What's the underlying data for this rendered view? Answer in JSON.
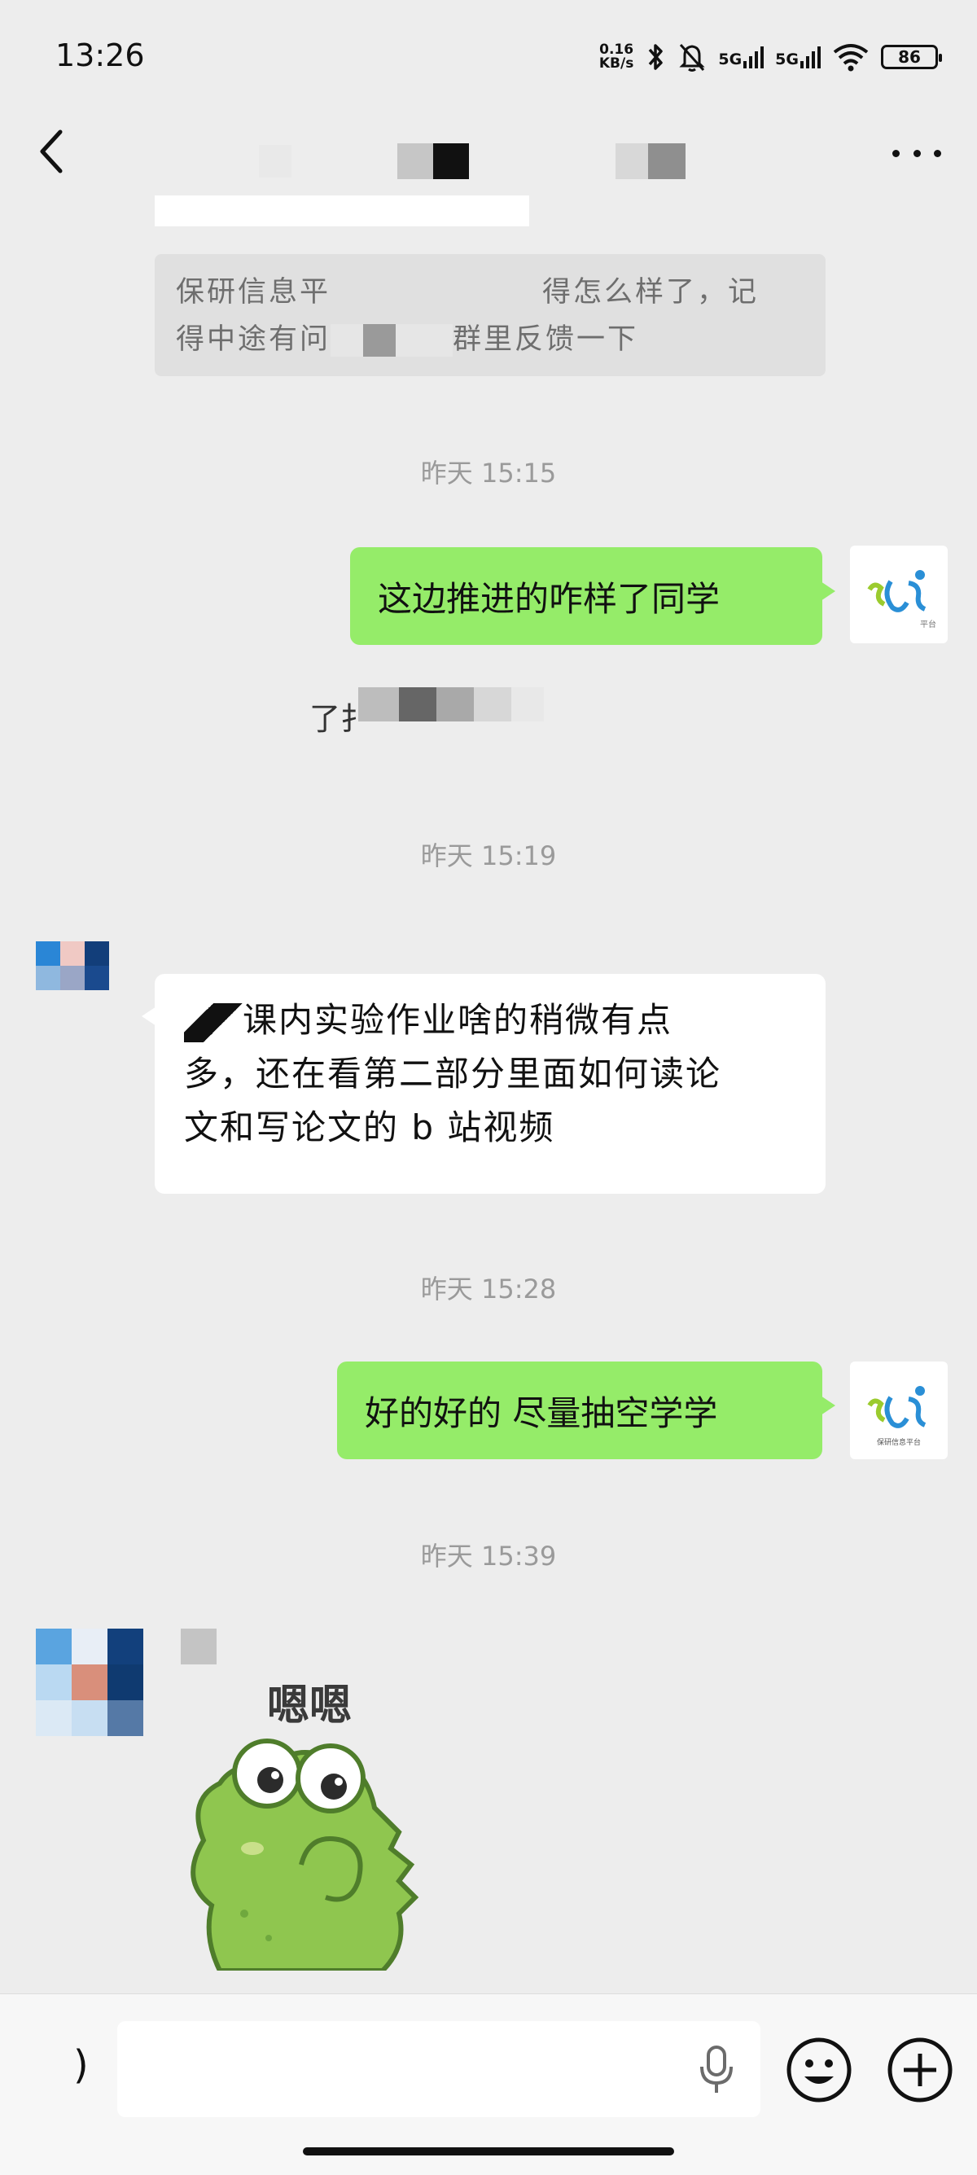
{
  "status_bar": {
    "time": "13:26",
    "net_speed_top": "0.16",
    "net_speed_bottom": "KB/s",
    "sig1": "5G",
    "sig2": "5G",
    "battery": "86"
  },
  "quoted": {
    "line1": "保研信息平",
    "line1_end": "得怎么样了，记",
    "line2": "得中途有问",
    "line2_end": "群里反馈一下"
  },
  "messages": {
    "ts1": "昨天 15:15",
    "m1": "这边推进的咋样了同学",
    "partial_reply": "了扌",
    "ts2": "昨天 15:19",
    "m2_line1": "课内实验作业啥的稍微有点",
    "m2_line2": "多，还在看第二部分里面如何读论",
    "m2_line3": "文和写论文的 b 站视频",
    "ts3": "昨天 15:28",
    "m3": "好的好的 尽量抽空学学",
    "ts4": "昨天 15:39",
    "sticker_text": "嗯嗯"
  },
  "avatar_me_caption": "保研信息平台",
  "avatar_me_caption_short": "平台",
  "input": {
    "placeholder": "",
    "voice_partial": ")"
  }
}
